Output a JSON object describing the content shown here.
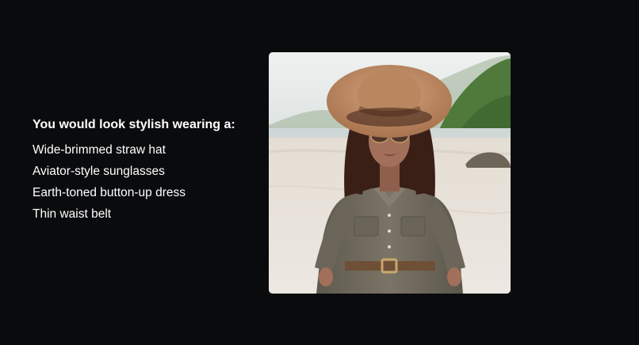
{
  "suggestions": {
    "heading": "You would look stylish wearing a:",
    "items": [
      "Wide-brimmed straw hat",
      "Aviator-style sunglasses",
      "Earth-toned button-up dress",
      "Thin waist belt"
    ]
  },
  "photo": {
    "subject": "woman-on-beach-portrait",
    "colors": {
      "background": "#0a0b0d",
      "sky": "#e8ecea",
      "sand": "#e7e2da",
      "foliage": "#4f7a3c",
      "hat": "#c08d66",
      "dress": "#6f6a5d",
      "hair": "#3a1f16",
      "skin": "#a2705a"
    }
  }
}
